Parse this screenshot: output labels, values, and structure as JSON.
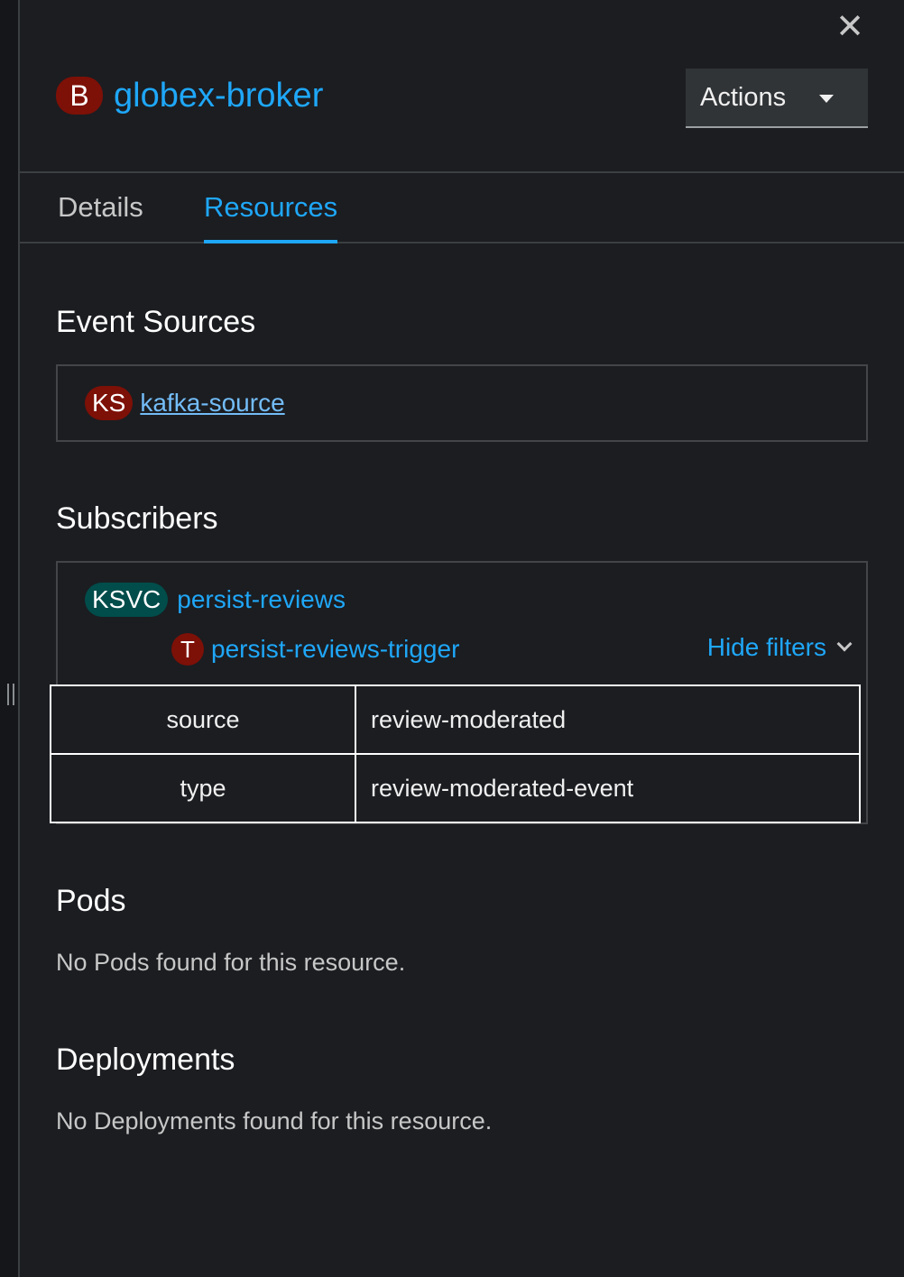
{
  "close": {
    "glyph": "✕"
  },
  "header": {
    "badge": "B",
    "title": "globex-broker",
    "actions_label": "Actions"
  },
  "tabs": [
    {
      "label": "Details"
    },
    {
      "label": "Resources"
    }
  ],
  "event_sources": {
    "title": "Event Sources",
    "items": [
      {
        "badge": "KS",
        "name": "kafka-source"
      }
    ]
  },
  "subscribers": {
    "title": "Subscribers",
    "service": {
      "badge": "KSVC",
      "name": "persist-reviews"
    },
    "trigger": {
      "badge": "T",
      "name": "persist-reviews-trigger"
    },
    "hide_filters_label": "Hide filters",
    "filters": [
      {
        "key": "source",
        "value": "review-moderated"
      },
      {
        "key": "type",
        "value": "review-moderated-event"
      }
    ]
  },
  "pods": {
    "title": "Pods",
    "empty": "No Pods found for this resource."
  },
  "deployments": {
    "title": "Deployments",
    "empty": "No Deployments found for this resource."
  },
  "colors": {
    "accent": "#1fa7f8",
    "link": "#73bcf7",
    "badge_red": "#7d1007",
    "badge_teal": "#004d4b",
    "background": "#1b1d21"
  }
}
